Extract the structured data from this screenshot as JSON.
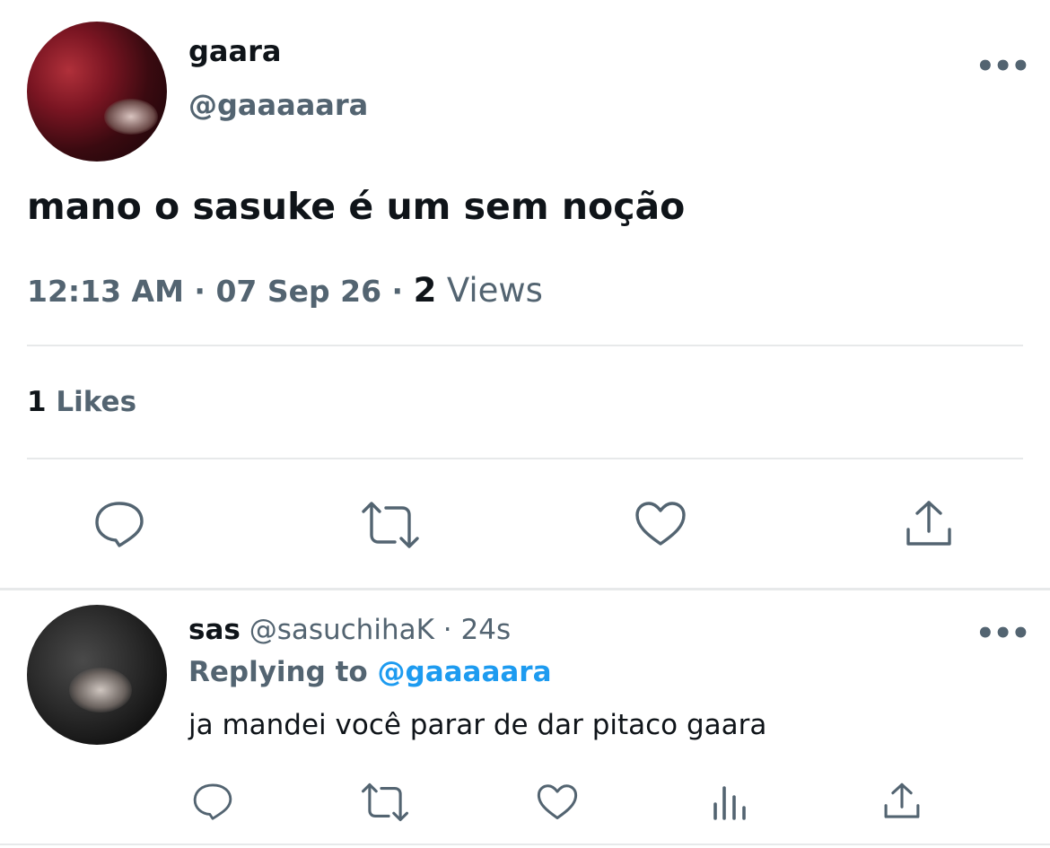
{
  "tweet": {
    "author_name": "gaara",
    "author_handle": "@gaaaaara",
    "more_label": "•••",
    "text": "mano o sasuke é um sem noção",
    "time": "12:13 AM",
    "date": "07 Sep 26",
    "view_count": "2",
    "views_label": "Views",
    "like_count": "1",
    "likes_label": "Likes",
    "actions": [
      "reply-icon",
      "retweet-icon",
      "like-icon",
      "share-icon"
    ]
  },
  "reply": {
    "author_name": "sas",
    "author_handle": "@sasuchihaK",
    "age": "24s",
    "more_label": "•••",
    "replying_to_label": "Replying to",
    "replying_to_handle": "@gaaaaara",
    "text": "ja mandei você parar de dar pitaco gaara",
    "actions": [
      "reply-icon",
      "retweet-icon",
      "like-icon",
      "analytics-icon",
      "share-icon"
    ]
  },
  "colors": {
    "primary_text": "#0f1419",
    "secondary_text": "#536471",
    "accent": "#1d9bf0",
    "divider": "#e7e9ea"
  }
}
